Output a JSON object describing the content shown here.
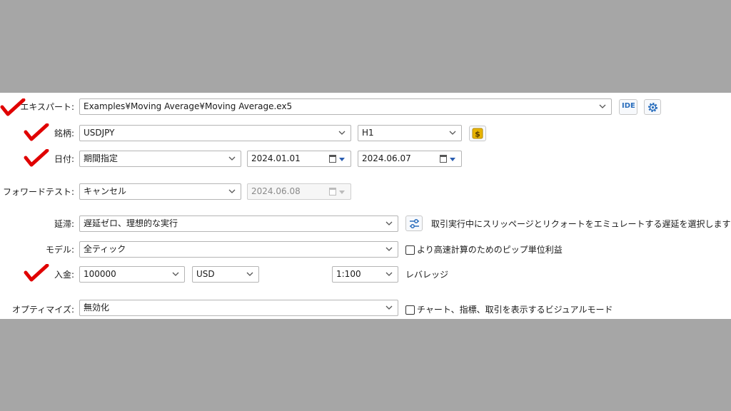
{
  "colors": {
    "check_mark": "#e00000",
    "accent_blue": "#2a6ebd",
    "dollar_gold": "#e8b400"
  },
  "rows": {
    "expert": {
      "label": "エキスパート:",
      "value": "Examples¥Moving Average¥Moving Average.ex5",
      "ide": "IDE"
    },
    "symbol": {
      "label": "銘柄:",
      "value": "USDJPY",
      "timeframe": "H1"
    },
    "date": {
      "label": "日付:",
      "mode": "期間指定",
      "from": "2024.01.01",
      "to": "2024.06.07"
    },
    "forward": {
      "label": "フォワードテスト:",
      "mode": "キャンセル",
      "date": "2024.06.08"
    },
    "delay": {
      "label": "延滞:",
      "value": "遅延ゼロ、理想的な実行",
      "hint": "取引実行中にスリッページとリクォートをエミュレートする遅延を選択します"
    },
    "model": {
      "label": "モデル:",
      "value": "全ティック",
      "checkbox_label": "より高速計算のためのピップ単位利益"
    },
    "deposit": {
      "label": "入金:",
      "amount": "100000",
      "currency": "USD",
      "leverage": "1:100",
      "leverage_label": "レバレッジ"
    },
    "optimize": {
      "label": "オプティマイズ:",
      "value": "無効化",
      "checkbox_label": "チャート、指標、取引を表示するビジュアルモード"
    }
  },
  "icons": [
    "check-mark-icon",
    "chevron-down-icon",
    "calendar-icon",
    "gear-icon",
    "dollar-icon",
    "sliders-icon"
  ]
}
